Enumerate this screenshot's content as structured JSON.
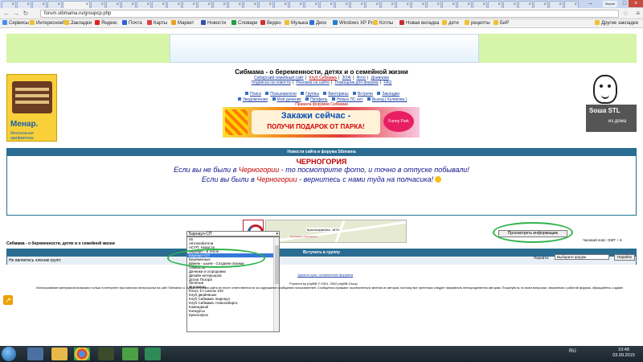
{
  "browser": {
    "address": "forum.sibmama.ru/groupcp.php",
    "profile_label": "Мария",
    "bookmarks": [
      {
        "label": "Сервисы",
        "color": "#4a8cf0"
      },
      {
        "label": "ИнтересноеПо...",
        "color": "#f0c030"
      },
      {
        "label": "Закладки",
        "color": "#f0c030"
      },
      {
        "label": "Яндекс",
        "color": "#e02020"
      },
      {
        "label": "Почта",
        "color": "#3060d0"
      },
      {
        "label": "Карты",
        "color": "#e04040"
      },
      {
        "label": "Маркет",
        "color": "#f0a020"
      },
      {
        "label": "Новости",
        "color": "#3050b0"
      },
      {
        "label": "Словари",
        "color": "#20a040"
      },
      {
        "label": "Видео",
        "color": "#d03030"
      },
      {
        "label": "Музыка",
        "color": "#f0c030"
      },
      {
        "label": "Диск",
        "color": "#3070d0"
      },
      {
        "label": "Windows XP Pr...",
        "color": "#2080d0"
      },
      {
        "label": "Котлы",
        "color": "#f0c030"
      },
      {
        "label": "Новая вкладка",
        "color": "#c03030"
      },
      {
        "label": "дети",
        "color": "#f0c030"
      },
      {
        "label": "рецепты",
        "color": "#f0c030"
      },
      {
        "label": "БиР",
        "color": "#f0c030"
      },
      {
        "label": "Другие закладки",
        "color": "#f0c030"
      }
    ]
  },
  "ads": {
    "left_brand": "Менар.",
    "left_sub": "Ментальная арифметика",
    "right_text1": "Sоша STL",
    "right_text2": "из дома",
    "promo_line1": "Закажи сейчас -",
    "promo_line2": "ПОЛУЧИ ПОДАРОК ОТ ПАРКА!",
    "promo_logo": "Funny Park",
    "map_label": "Красноармейск, 187Н",
    "map_sub": "Остановка «Телецентр»"
  },
  "header": {
    "title": "Сибмама - о беременности, детях и о семейной жизни",
    "links_row1": [
      "Сибирский семейный сайт",
      "Клуб Сибмама",
      "ЗОЖ",
      "Фото",
      "Дневники"
    ],
    "links_row2": [
      "Подписка на новости",
      "Реклама на сайте",
      "Помощник для форума",
      "FAQ"
    ],
    "nav_row3": [
      "Поиск",
      "Пользователи",
      "Группы",
      "Викторины",
      "Встречи",
      "Закладки"
    ],
    "nav_row4": [
      "Уведомления",
      "Мой дневник",
      "Профиль",
      "Новых ЛС нет",
      "Выход [ Куликова ]"
    ],
    "rules": "Правила форумов Сибмама"
  },
  "news": {
    "head": "Новости сайта и форума Sibmama",
    "title": "ЧЕРНОГОРИЯ",
    "line1_a": "Если вы не были в ",
    "line1_b": "Черногории",
    "line1_c": " - то посмотрите фото, и точно в отпуске побывали!",
    "line2_a": "Если вы были в ",
    "line2_b": "Черногории",
    "line2_c": " - вернитесь с нами туда на полчасика!"
  },
  "breadcrumb": "Сибмама - о беременности, детях и о семейной жизни",
  "group": {
    "head": "Вступить в группу",
    "label": "Не являетесь членом групп:",
    "selected": "Барнаул-СП",
    "view_button": "Просмотреть информацию",
    "options": [
      "45",
      "Автолюбители",
      "АСУП, Новости",
      "Барнаул - в тепле",
      "Барнаул-СП",
      "Беременные",
      "Вяжем - шьем - Создаем своими",
      "Гимнасты",
      "Дачники и огородники",
      "Дизайн интерьеров",
      "Доска Позора",
      "Зеленые",
      "Игроманы",
      "Класс 1А школы 102",
      "Клуб двойняшек",
      "Клуб Сибмама. Барнаул",
      "Клуб Сибмама. Новосибирск",
      "Командный",
      "Конкурсы",
      "Красноярск"
    ]
  },
  "footer": {
    "timezone": "Часовой пояс: GMT + 6",
    "jump_label": "Перейти:",
    "jump_select": "Выберите форум",
    "jump_button": "Перейти",
    "delete_cookies": "Удалить куки, оставленные форумом",
    "powered": "Powered by phpBB © 2001, 2002 phpBB Group",
    "disclaimer": "Использование материалов возможно только в интернете при наличии гиперссылки на сайт Sibmama.ru. Администрация сайта не несет ответственности за содержание сообщений пользователей. Сообщения отражают исключительно мнения их авторов, поэтому все претензии следует направлять непосредственно авторам. Пожалуйста, по всем вопросам, связанным с работой форума, обращайтесь к администрации."
  },
  "taskbar": {
    "lang": "RU",
    "time": "10:48",
    "date": "03.09.2015"
  }
}
